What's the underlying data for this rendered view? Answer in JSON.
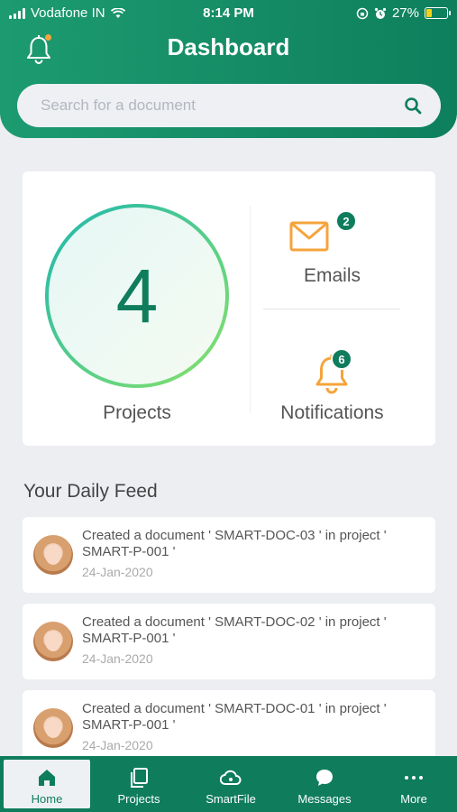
{
  "status_bar": {
    "carrier": "Vodafone IN",
    "time": "8:14 PM",
    "battery": "27%"
  },
  "header": {
    "title": "Dashboard"
  },
  "search": {
    "placeholder": "Search for a document"
  },
  "summary": {
    "projects_count": "4",
    "projects_label": "Projects",
    "emails_label": "Emails",
    "emails_count": "2",
    "notifications_label": "Notifications",
    "notifications_count": "6"
  },
  "feed": {
    "title": "Your Daily Feed",
    "items": [
      {
        "text": "Created a document ' SMART-DOC-03 '  in project ' SMART-P-001 '",
        "date": "24-Jan-2020"
      },
      {
        "text": "Created a document ' SMART-DOC-02 '  in project ' SMART-P-001 '",
        "date": "24-Jan-2020"
      },
      {
        "text": "Created a document ' SMART-DOC-01 '  in project ' SMART-P-001 '",
        "date": "24-Jan-2020"
      }
    ]
  },
  "nav": {
    "items": [
      {
        "label": "Home",
        "icon": "home-icon"
      },
      {
        "label": "Projects",
        "icon": "projects-icon"
      },
      {
        "label": "SmartFile",
        "icon": "smartfile-icon"
      },
      {
        "label": "Messages",
        "icon": "messages-icon"
      },
      {
        "label": "More",
        "icon": "more-icon"
      }
    ]
  },
  "colors": {
    "brand": "#0f7d5c",
    "accent": "#f5a43b",
    "background": "#eceef2"
  }
}
